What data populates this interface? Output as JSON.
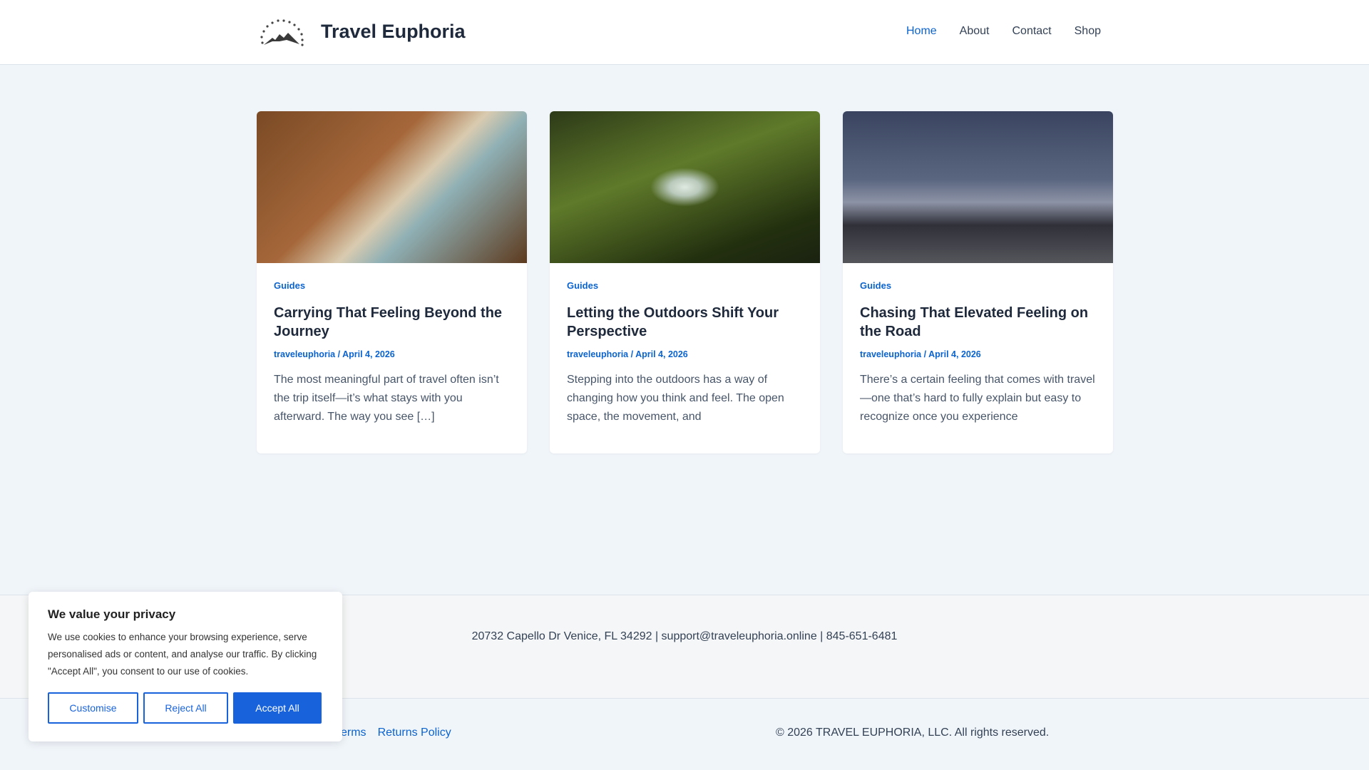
{
  "header": {
    "site_title": "Travel Euphoria",
    "nav": [
      {
        "label": "Home"
      },
      {
        "label": "About"
      },
      {
        "label": "Contact"
      },
      {
        "label": "Shop"
      }
    ]
  },
  "posts": [
    {
      "category": "Guides",
      "title": "Carrying That Feeling Beyond the Journey",
      "author": "traveleuphoria",
      "date": "April 4, 2026",
      "excerpt": "The most meaningful part of travel often isn’t the trip itself—it’s what stays with you afterward. The way you see […]"
    },
    {
      "category": "Guides",
      "title": "Letting the Outdoors Shift Your Perspective",
      "author": "traveleuphoria",
      "date": "April 4, 2026",
      "excerpt": "Stepping into the outdoors has a way of changing how you think and feel. The open space, the movement, and"
    },
    {
      "category": "Guides",
      "title": "Chasing That Elevated Feeling on the Road",
      "author": "traveleuphoria",
      "date": "April 4, 2026",
      "excerpt": "There’s a certain feeling that comes with travel—one that’s hard to fully explain but easy to recognize once you experience"
    }
  ],
  "footer": {
    "address": "20732 Capello Dr Venice, FL 34292 | support@traveleuphoria.online | 845-651-6481",
    "links": [
      {
        "label": "Terms"
      },
      {
        "label": "Returns Policy"
      }
    ],
    "copyright": "© 2026 TRAVEL EUPHORIA, LLC. All rights reserved."
  },
  "cookie": {
    "title": "We value your privacy",
    "text": "We use cookies to enhance your browsing experience, serve personalised ads or content, and analyse our traffic. By clicking \"Accept All\", you consent to our use of cookies.",
    "customise": "Customise",
    "reject": "Reject All",
    "accept": "Accept All"
  }
}
